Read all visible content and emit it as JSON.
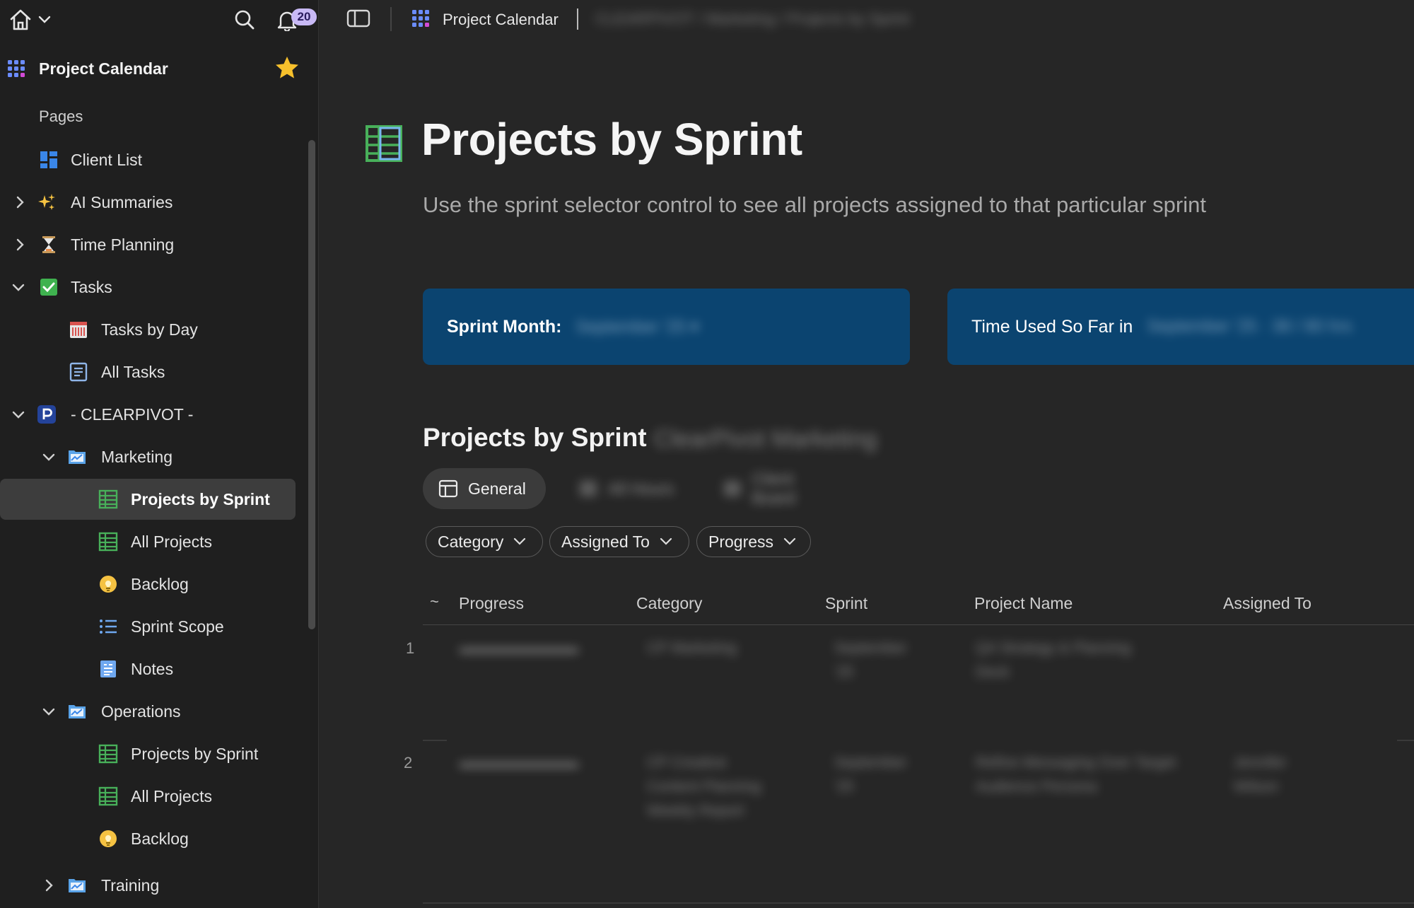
{
  "sidebar": {
    "notifications_count": "20",
    "doc_title": "Project Calendar",
    "pages_label": "Pages",
    "items": [
      {
        "label": "Client List"
      },
      {
        "label": "AI Summaries"
      },
      {
        "label": "Time Planning"
      },
      {
        "label": "Tasks"
      },
      {
        "label": "Tasks by Day"
      },
      {
        "label": "All Tasks"
      },
      {
        "label": "- CLEARPIVOT -"
      },
      {
        "label": "Marketing"
      },
      {
        "label": "Projects by Sprint"
      },
      {
        "label": "All Projects"
      },
      {
        "label": "Backlog"
      },
      {
        "label": "Sprint Scope"
      },
      {
        "label": "Notes"
      },
      {
        "label": "Operations"
      },
      {
        "label": "Projects by Sprint"
      },
      {
        "label": "All Projects"
      },
      {
        "label": "Backlog"
      },
      {
        "label": "Training"
      }
    ]
  },
  "topbar": {
    "breadcrumb_title": "Project Calendar",
    "breadcrumb_rest": "CLEARPIVOT  /  Marketing  /  Projects by Sprint"
  },
  "main": {
    "title": "Projects by Sprint",
    "subtitle": "Use the sprint selector control to see all projects assigned to that particular sprint",
    "card1_label": "Sprint Month:",
    "card1_value": "September '25 ▾",
    "card2_label": "Time Used So Far in",
    "card2_value": "September '25  ·  38 / 80 hrs",
    "section_title": "Projects by Sprint",
    "section_subtitle": "ClearPivot Marketing",
    "views": [
      {
        "label": "General"
      },
      {
        "label": "All Hours"
      },
      {
        "label": "Client Board"
      }
    ],
    "filters": [
      {
        "label": "Category"
      },
      {
        "label": "Assigned To"
      },
      {
        "label": "Progress"
      }
    ],
    "table": {
      "sort_glyph": "~",
      "columns": [
        "Progress",
        "Category",
        "Sprint",
        "Project Name",
        "Assigned To"
      ],
      "rows": [
        {
          "num": "1",
          "progress": "▬▬▬▬▬▬▬▬",
          "category": "CP Marketing",
          "sprint": "September\n'25",
          "project": "Q4 Strategy & Planning\nDeck",
          "assigned": ""
        },
        {
          "num": "2",
          "progress": "▬▬▬▬▬▬▬▬",
          "category": "CP Creative\nContent Planning\nWeekly Report",
          "sprint": "September\n'25",
          "project": "Refine Messaging Over Target\nAudience Persona",
          "assigned": "Jennifer\nWilson"
        }
      ]
    }
  },
  "colors": {
    "sidebar_bg": "#1f1f1f",
    "main_bg": "#262626",
    "card_bg": "#0b4470",
    "active_item_bg": "#3d3d3d",
    "badge_bg": "#c8b9f5"
  }
}
